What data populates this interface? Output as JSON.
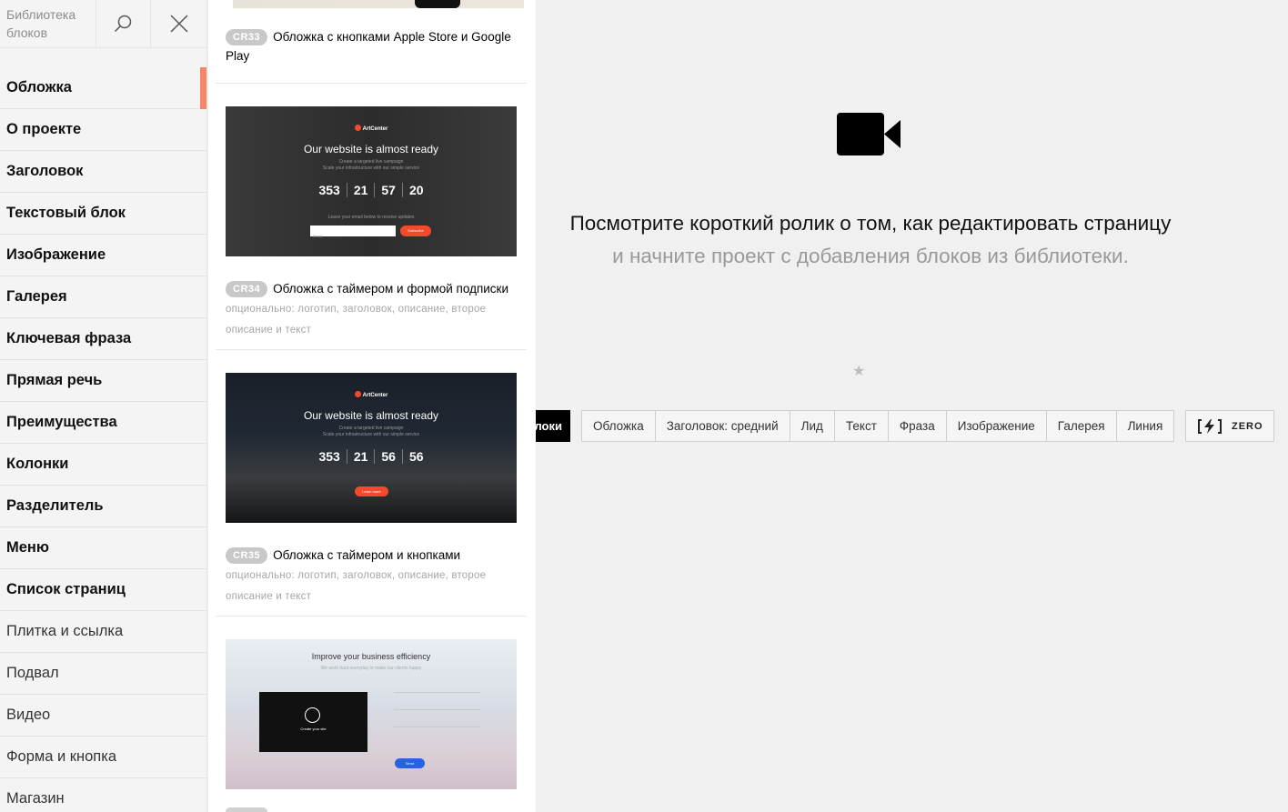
{
  "sidebar": {
    "title": "Библиотека блоков",
    "items": [
      {
        "label": "Обложка",
        "active": true,
        "weight": "bold"
      },
      {
        "label": "О проекте",
        "weight": "bold"
      },
      {
        "label": "Заголовок",
        "weight": "bold"
      },
      {
        "label": "Текстовый блок",
        "weight": "bold"
      },
      {
        "label": "Изображение",
        "weight": "bold"
      },
      {
        "label": "Галерея",
        "weight": "bold"
      },
      {
        "label": "Ключевая фраза",
        "weight": "bold"
      },
      {
        "label": "Прямая речь",
        "weight": "bold"
      },
      {
        "label": "Преимущества",
        "weight": "bold"
      },
      {
        "label": "Колонки",
        "weight": "bold"
      },
      {
        "label": "Разделитель",
        "weight": "bold"
      },
      {
        "label": "Меню",
        "weight": "bold"
      },
      {
        "label": "Список страниц",
        "weight": "bold"
      },
      {
        "label": "Плитка и ссылка",
        "weight": "light"
      },
      {
        "label": "Подвал",
        "weight": "light"
      },
      {
        "label": "Видео",
        "weight": "light"
      },
      {
        "label": "Форма и кнопка",
        "weight": "light"
      },
      {
        "label": "Магазин",
        "weight": "light"
      }
    ],
    "accent_color": "#fa8669"
  },
  "cards": [
    {
      "code": "CR33",
      "title": "Обложка с кнопками Apple Store и Google Play",
      "optional": ""
    },
    {
      "code": "CR34",
      "title": "Обложка с таймером и формой подписки",
      "optional": "опционально: логотип, заголовок, описание, второе описание и текст",
      "thumb": {
        "logo": "ArtCenter",
        "title": "Our website is almost ready",
        "sub1": "Create a targeted live campaign",
        "sub2": "Scale your infrastructure with our simple service",
        "timer": [
          "353",
          "21",
          "57",
          "20"
        ],
        "note": "Leave your email below to receive updates",
        "email_placeholder": "Email",
        "button": "Subscribe"
      }
    },
    {
      "code": "CR35",
      "title": "Обложка с таймером и кнопками",
      "optional": "опционально: логотип, заголовок, описание, второе описание и текст",
      "thumb": {
        "logo": "ArtCenter",
        "title": "Our website is almost ready",
        "sub1": "Create a targeted live campaign",
        "sub2": "Scale your infrastructure with our simple service",
        "timer": [
          "353",
          "21",
          "56",
          "56"
        ],
        "button": "Learn more"
      }
    },
    {
      "thumb": {
        "title": "Improve your business efficiency",
        "sub": "We work hard everyday to make our clients happy",
        "video_caption": "Create your site",
        "button": "Send"
      }
    }
  ],
  "main": {
    "headline": "Посмотрите короткий ролик о том, как редактировать страницу",
    "subline": "и начните проект с добавления блоков из библиотеки.",
    "all_blocks_label": "Все блоки",
    "quick_blocks": [
      "Обложка",
      "Заголовок: средний",
      "Лид",
      "Текст",
      "Фраза",
      "Изображение",
      "Галерея",
      "Линия"
    ],
    "zero_label": "ZERO"
  }
}
